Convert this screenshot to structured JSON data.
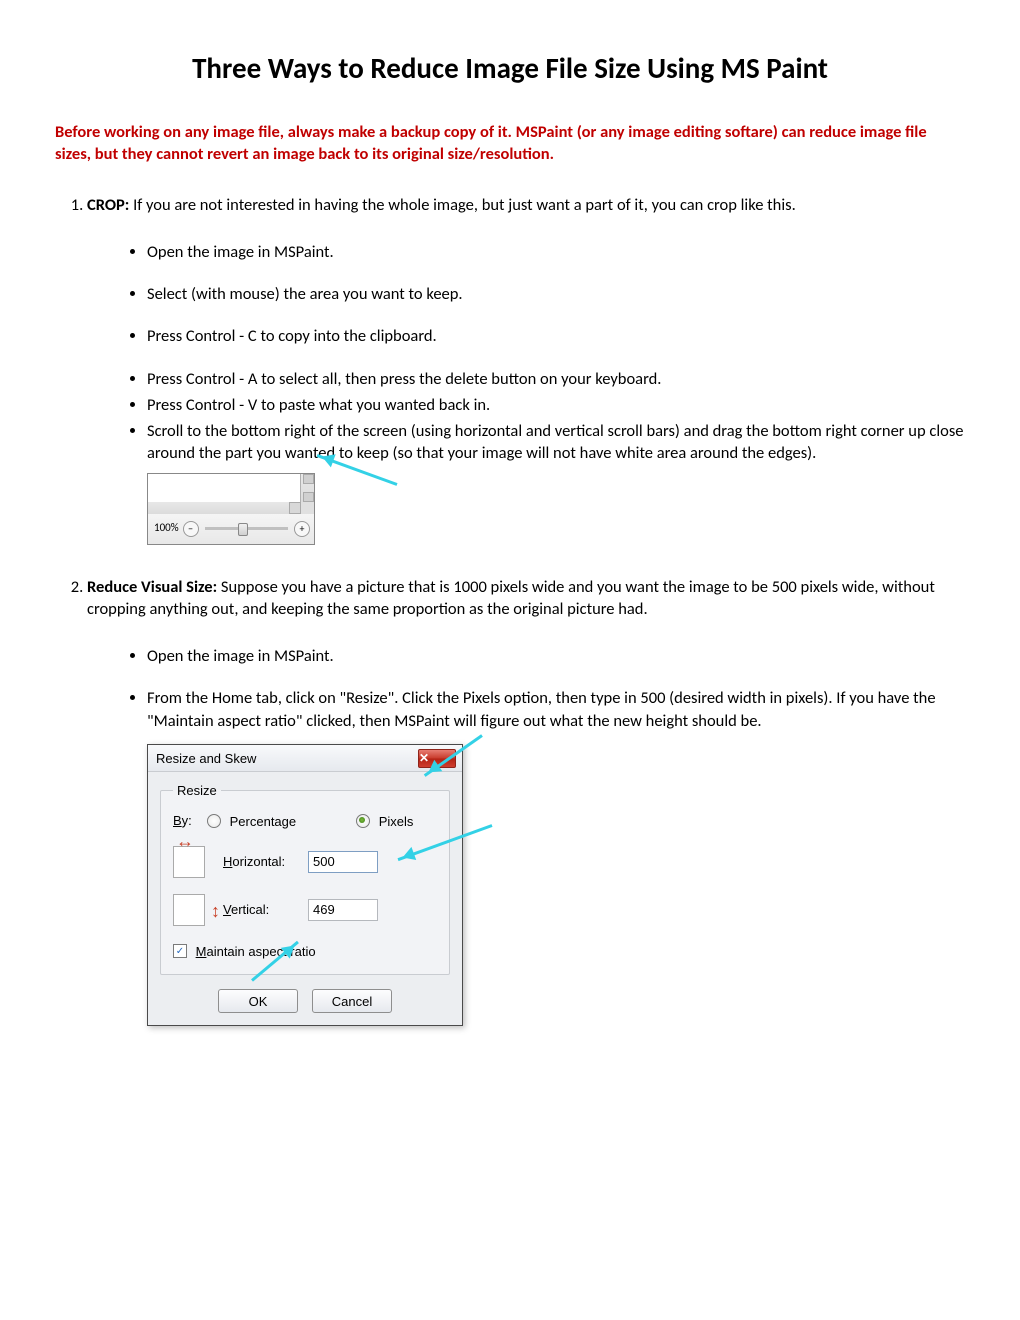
{
  "title": "Three Ways to Reduce Image File Size Using MS Paint",
  "warning": "Before working on any image file, always make a backup copy of it.  MSPaint (or any image editing softare) can reduce image file sizes, but they cannot revert an image back to its original size/resolution.",
  "step1": {
    "heading_bold": "CROP:",
    "heading_rest": "  If you are not interested in having the whole image, but just want a part of it, you can crop like this.",
    "bullets": {
      "b1": "Open the image in MSPaint.",
      "b2": "Select (with mouse) the area you want to keep.",
      "b3": "Press Control - C to copy into the clipboard.",
      "b4": "Press Control - A to select all, then press the delete button on your keyboard.",
      "b5": "Press Control - V to paste what you wanted back in.",
      "b6": "Scroll to the bottom right of the screen (using horizontal and vertical scroll bars) and drag the bottom right corner up close around the part you wanted to keep (so that your image will not have white area around the edges)."
    },
    "zoom_label": "100%"
  },
  "step2": {
    "heading_bold": "Reduce Visual Size:",
    "heading_rest": "  Suppose you have a picture that is 1000 pixels wide and you want the image to be 500 pixels wide, without cropping anything out, and keeping the same proportion as the original picture had.",
    "bullets": {
      "b1": "Open the image in MSPaint.",
      "b2": "From the Home tab, click on \"Resize\". Click the Pixels option, then type in 500 (desired width in pixels). If you have the \"Maintain aspect ratio\" clicked, then MSPaint will figure out what the new height should be."
    }
  },
  "dialog": {
    "title": "Resize and Skew",
    "close_glyph": "✕",
    "group_legend": "Resize",
    "by_key": "B",
    "by_rest": "y:",
    "percentage": "Percentage",
    "pixels": "Pixels",
    "h_key": "H",
    "h_rest": "orizontal:",
    "v_key": "V",
    "v_rest": "ertical:",
    "h_val": "500",
    "v_val": "469",
    "check_glyph": "✓",
    "m_key": "M",
    "m_rest": "aintain aspect ratio",
    "ok": "OK",
    "cancel": "Cancel",
    "horiz_glyph": "↔",
    "vert_glyph": "↕"
  }
}
